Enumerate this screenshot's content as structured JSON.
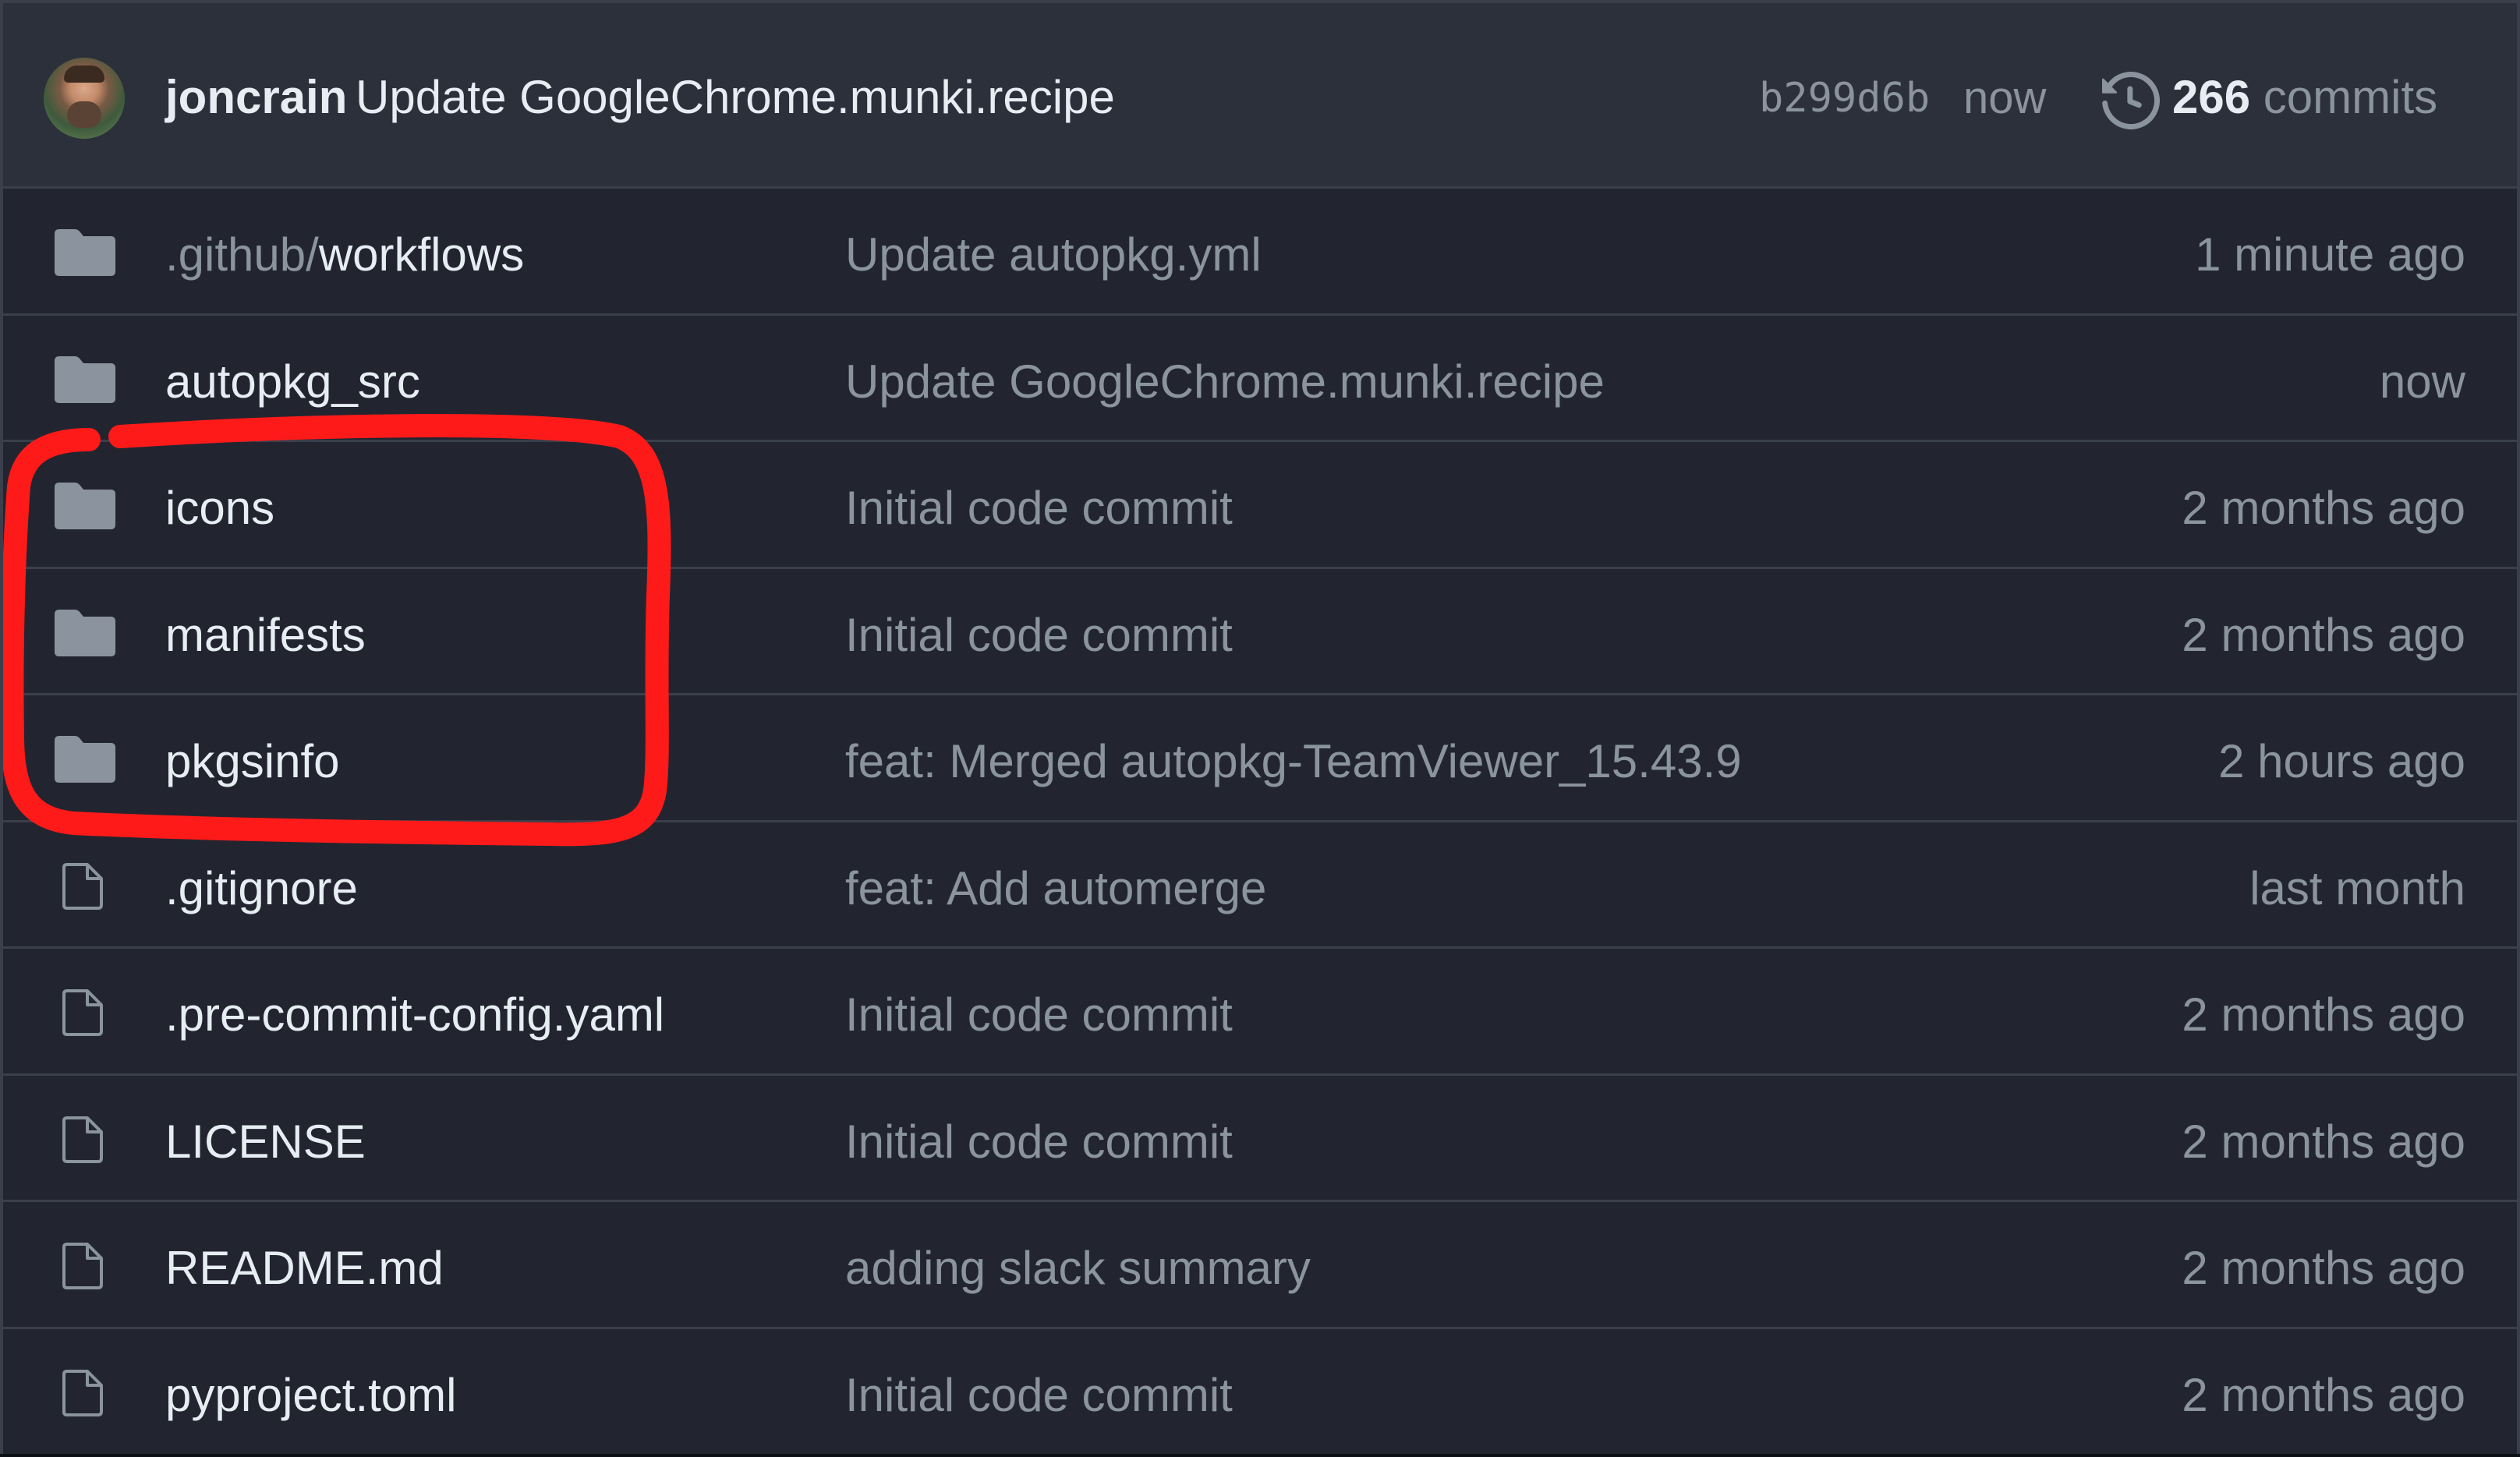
{
  "latest_commit": {
    "author": "joncrain",
    "message": "Update GoogleChrome.munki.recipe",
    "sha": "b299d6b",
    "time": "now",
    "commit_count": "266",
    "commit_label": "commits"
  },
  "files": [
    {
      "type": "folder",
      "name_prefix": ".github/",
      "name": "workflows",
      "message": "Update autopkg.yml",
      "age": "1 minute ago"
    },
    {
      "type": "folder",
      "name_prefix": "",
      "name": "autopkg_src",
      "message": "Update GoogleChrome.munki.recipe",
      "age": "now"
    },
    {
      "type": "folder",
      "name_prefix": "",
      "name": "icons",
      "message": "Initial code commit",
      "age": "2 months ago"
    },
    {
      "type": "folder",
      "name_prefix": "",
      "name": "manifests",
      "message": "Initial code commit",
      "age": "2 months ago"
    },
    {
      "type": "folder",
      "name_prefix": "",
      "name": "pkgsinfo",
      "message": "feat: Merged autopkg-TeamViewer_15.43.9",
      "age": "2 hours ago"
    },
    {
      "type": "file",
      "name_prefix": "",
      "name": ".gitignore",
      "message": "feat: Add automerge",
      "age": "last month"
    },
    {
      "type": "file",
      "name_prefix": "",
      "name": ".pre-commit-config.yaml",
      "message": "Initial code commit",
      "age": "2 months ago"
    },
    {
      "type": "file",
      "name_prefix": "",
      "name": "LICENSE",
      "message": "Initial code commit",
      "age": "2 months ago"
    },
    {
      "type": "file",
      "name_prefix": "",
      "name": "README.md",
      "message": "adding slack summary",
      "age": "2 months ago"
    },
    {
      "type": "file",
      "name_prefix": "",
      "name": "pyproject.toml",
      "message": "Initial code commit",
      "age": "2 months ago"
    }
  ],
  "colors": {
    "background": "#22252f",
    "header": "#2c303b",
    "text": "#e6edf3",
    "muted": "#8b949e",
    "annotation": "#ff1a1a"
  }
}
